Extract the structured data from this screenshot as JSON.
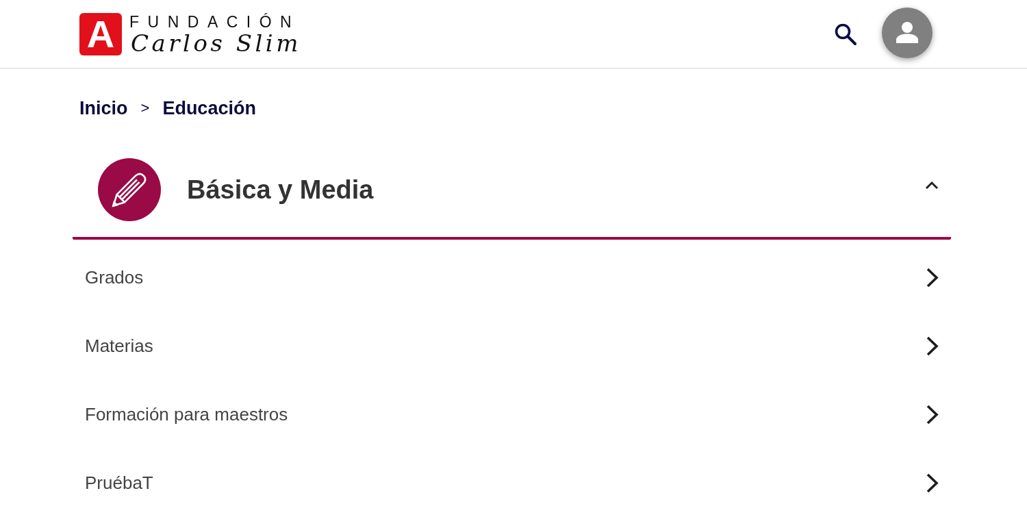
{
  "header": {
    "logo": {
      "badge": "A",
      "name": "FUNDACIÓN",
      "script": "Carlos Slim"
    }
  },
  "breadcrumb": [
    {
      "kind": "link",
      "label": "Inicio"
    },
    {
      "kind": "separator",
      "label": ">"
    },
    {
      "kind": "link",
      "label": "Educación"
    }
  ],
  "section": {
    "title": "Básica y Media",
    "expanded": true,
    "items": [
      {
        "label": "Grados"
      },
      {
        "label": "Materias"
      },
      {
        "label": "Formación para maestros"
      },
      {
        "label": "PruébaT"
      }
    ]
  }
}
